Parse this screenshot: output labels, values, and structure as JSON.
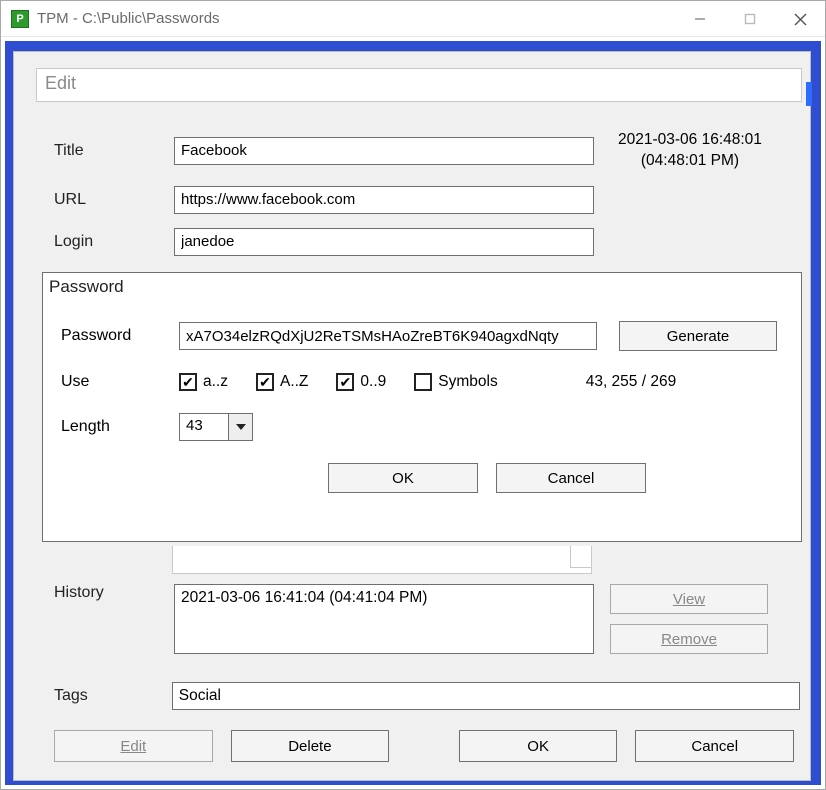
{
  "window": {
    "title": "TPM - C:\\Public\\Passwords",
    "icon_letter": "P"
  },
  "header": {
    "label": "Edit"
  },
  "timestamp": {
    "line1": "2021-03-06 16:48:01",
    "line2": "(04:48:01 PM)"
  },
  "fields": {
    "title_label": "Title",
    "title_value": "Facebook",
    "url_label": "URL",
    "url_value": "https://www.facebook.com",
    "login_label": "Login",
    "login_value": "janedoe"
  },
  "password_group": {
    "legend": "Password",
    "password_label": "Password",
    "password_value": "xA7O34elzRQdXjU2ReTSMsHAoZreBT6K940agxdNqty",
    "generate_label": "Generate",
    "use_label": "Use",
    "check_az": "a..z",
    "check_AZ": "A..Z",
    "check_09": "0..9",
    "check_sym": "Symbols",
    "checked_az": "✔",
    "checked_AZ": "✔",
    "checked_09": "✔",
    "checked_sym": "",
    "counter": "43, 255 / 269",
    "length_label": "Length",
    "length_value": "43",
    "ok_label": "OK",
    "cancel_label": "Cancel"
  },
  "history": {
    "label": "History",
    "entry": "2021-03-06 16:41:04 (04:41:04 PM)",
    "view_label": "View",
    "remove_label": "Remove"
  },
  "tags": {
    "label": "Tags",
    "value": "Social"
  },
  "bottom": {
    "edit_label": "Edit",
    "delete_label": "Delete",
    "ok_label": "OK",
    "cancel_label": "Cancel"
  }
}
